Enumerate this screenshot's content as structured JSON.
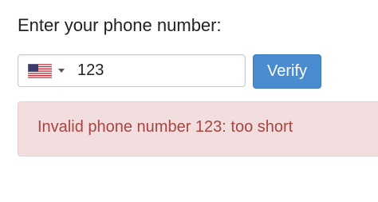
{
  "form": {
    "prompt": "Enter your phone number:",
    "country": {
      "selected": "United States",
      "flag_icon": "us-flag-icon"
    },
    "phone_input": {
      "value": "123",
      "placeholder": ""
    },
    "verify_label": "Verify"
  },
  "alert": {
    "message": "Invalid phone number 123: too short"
  },
  "colors": {
    "button_bg": "#4a8cd0",
    "alert_bg": "#f2dede",
    "alert_text": "#a94442"
  }
}
